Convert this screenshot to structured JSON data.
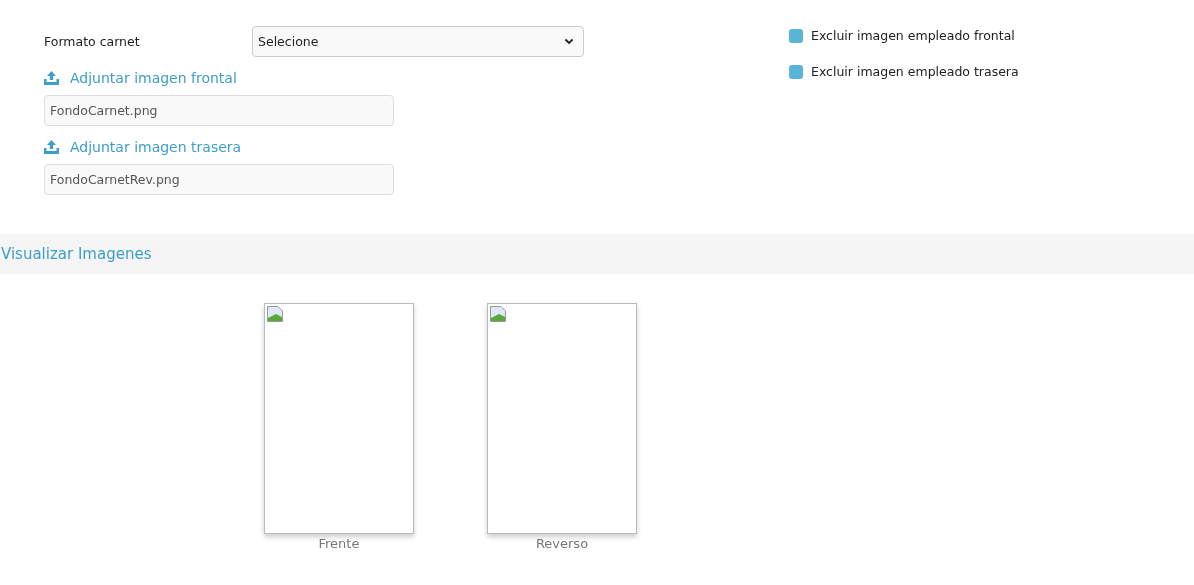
{
  "format_field": {
    "label": "Formato carnet",
    "value": "Selecione"
  },
  "uploads": [
    {
      "link": "Adjuntar imagen frontal",
      "file": "FondoCarnet.png"
    },
    {
      "link": "Adjuntar imagen trasera",
      "file": "FondoCarnetRev.png"
    }
  ],
  "options": [
    {
      "label": "Excluir imagen empleado frontal",
      "checked": false
    },
    {
      "label": "Excluir imagen empleado trasera",
      "checked": false
    }
  ],
  "preview": {
    "title": "Visualizar Imagenes",
    "images": [
      {
        "caption": "Frente"
      },
      {
        "caption": "Reverso"
      }
    ]
  }
}
